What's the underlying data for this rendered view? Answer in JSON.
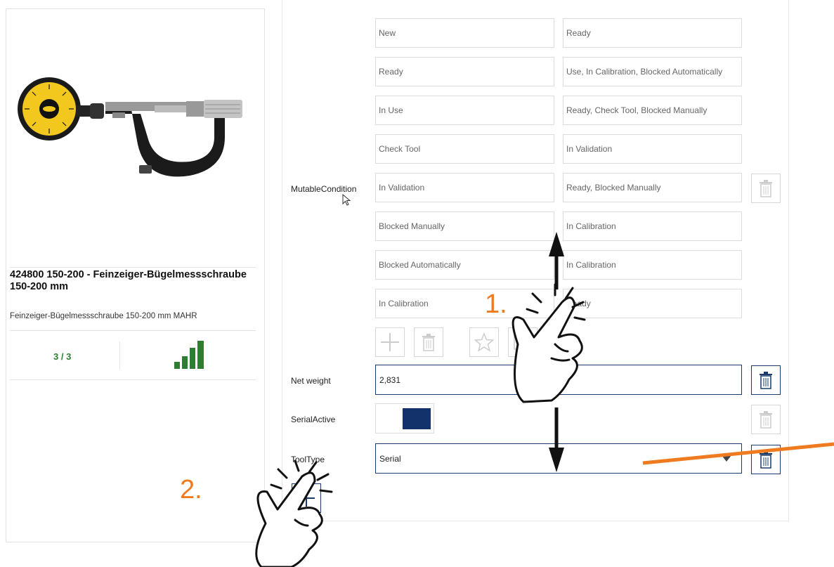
{
  "product": {
    "title": "424800 150-200 - Feinzeiger-Bügelmessschraube 150-200 mm",
    "subtitle": "Feinzeiger-Bügelmessschraube 150-200 mm MAHR",
    "count": "3 / 3",
    "image_icon": "micrometer-image",
    "signal_icon": "signal-bars-icon",
    "accent_color": "#2f7d32"
  },
  "mutable_condition": {
    "label": "MutableCondition",
    "rows": [
      {
        "from": "New",
        "to": "Ready"
      },
      {
        "from": "Ready",
        "to": "Use, In Calibration, Blocked Automatically"
      },
      {
        "from": "In Use",
        "to": "Ready, Check Tool, Blocked Manually"
      },
      {
        "from": "Check Tool",
        "to": "In Validation"
      },
      {
        "from": "In Validation",
        "to": "Ready, Blocked Manually"
      },
      {
        "from": "Blocked Manually",
        "to": "In Calibration"
      },
      {
        "from": "Blocked Automatically",
        "to": "In Calibration"
      },
      {
        "from": "In Calibration",
        "to": "Ready"
      }
    ]
  },
  "net_weight": {
    "label": "Net weight",
    "value": "2,831"
  },
  "serial_active": {
    "label": "SerialActive",
    "color": "#13316b"
  },
  "tool_type": {
    "label": "ToolType",
    "value": "Serial"
  },
  "annotations": {
    "step1": "1.",
    "step2": "2.",
    "color": "#f07a1e"
  }
}
